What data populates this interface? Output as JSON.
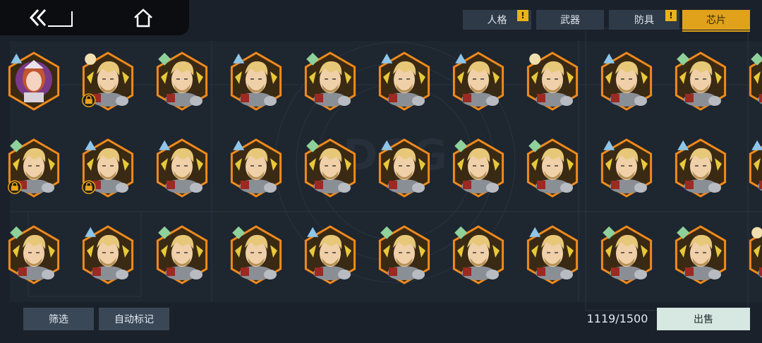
{
  "header": {
    "back_icon": "double-chevron-back-icon",
    "home_icon": "home-icon"
  },
  "tabs": [
    {
      "label": "人格",
      "warn": "!",
      "active": false
    },
    {
      "label": "武器",
      "warn": "",
      "active": false
    },
    {
      "label": "防具",
      "warn": "!",
      "active": false
    },
    {
      "label": "芯片",
      "warn": "",
      "active": true
    }
  ],
  "items": {
    "row1": [
      {
        "portrait": "girl",
        "rank": "triangle",
        "locked": false
      },
      {
        "portrait": "hero",
        "rank": "circle",
        "locked": true
      },
      {
        "portrait": "hero",
        "rank": "diamond",
        "locked": false
      },
      {
        "portrait": "hero",
        "rank": "triangle",
        "locked": false
      },
      {
        "portrait": "hero",
        "rank": "diamond",
        "locked": false
      },
      {
        "portrait": "hero",
        "rank": "triangle",
        "locked": false
      },
      {
        "portrait": "hero",
        "rank": "triangle",
        "locked": false
      },
      {
        "portrait": "hero",
        "rank": "circle",
        "locked": false
      },
      {
        "portrait": "hero",
        "rank": "triangle",
        "locked": false
      },
      {
        "portrait": "hero",
        "rank": "diamond",
        "locked": false
      },
      {
        "portrait": "hero",
        "rank": "diamond",
        "locked": false
      }
    ],
    "row2": [
      {
        "portrait": "hero",
        "rank": "diamond",
        "locked": true
      },
      {
        "portrait": "hero",
        "rank": "triangle",
        "locked": true
      },
      {
        "portrait": "hero",
        "rank": "triangle",
        "locked": false
      },
      {
        "portrait": "hero",
        "rank": "triangle",
        "locked": false
      },
      {
        "portrait": "hero",
        "rank": "diamond",
        "locked": false
      },
      {
        "portrait": "hero",
        "rank": "triangle",
        "locked": false
      },
      {
        "portrait": "hero",
        "rank": "diamond",
        "locked": false
      },
      {
        "portrait": "hero",
        "rank": "diamond",
        "locked": false
      },
      {
        "portrait": "hero",
        "rank": "triangle",
        "locked": false
      },
      {
        "portrait": "hero",
        "rank": "triangle",
        "locked": false
      },
      {
        "portrait": "hero",
        "rank": "triangle",
        "locked": false
      }
    ],
    "row3": [
      {
        "portrait": "hero",
        "rank": "diamond",
        "locked": false
      },
      {
        "portrait": "hero",
        "rank": "triangle",
        "locked": false
      },
      {
        "portrait": "hero",
        "rank": "diamond",
        "locked": false
      },
      {
        "portrait": "hero",
        "rank": "diamond",
        "locked": false
      },
      {
        "portrait": "hero",
        "rank": "triangle",
        "locked": false
      },
      {
        "portrait": "hero",
        "rank": "diamond",
        "locked": false
      },
      {
        "portrait": "hero",
        "rank": "diamond",
        "locked": false
      },
      {
        "portrait": "hero",
        "rank": "triangle",
        "locked": false
      },
      {
        "portrait": "hero",
        "rank": "diamond",
        "locked": false
      },
      {
        "portrait": "hero",
        "rank": "diamond",
        "locked": false
      },
      {
        "portrait": "hero",
        "rank": "circle",
        "locked": false
      }
    ]
  },
  "colors": {
    "frame_orange": "#f08a1c",
    "triangle": "#8ec6ea",
    "diamond": "#8fd19a",
    "circle": "#f2dfb0",
    "accent": "#e0a21a"
  },
  "footer": {
    "filter_label": "筛选",
    "auto_mark_label": "自动标记",
    "count": "1119/1500",
    "sell_label": "出售"
  }
}
